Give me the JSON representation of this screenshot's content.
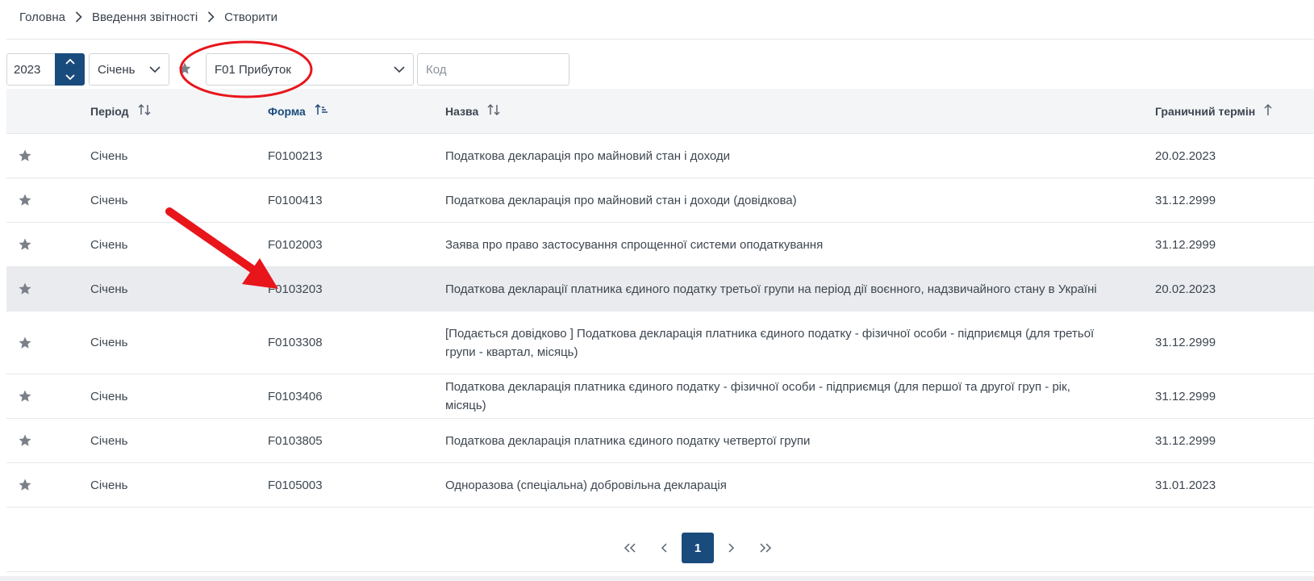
{
  "breadcrumb": [
    "Головна",
    "Введення звітності",
    "Створити"
  ],
  "filters": {
    "year": "2023",
    "month": "Січень",
    "form": "F01 Прибуток",
    "code_placeholder": "Код"
  },
  "table": {
    "columns": [
      "Період",
      "Форма",
      "Назва",
      "Граничний термін"
    ],
    "rows": [
      {
        "period": "Січень",
        "form": "F0100213",
        "name": "Податкова декларація про майновий стан і доходи",
        "deadline": "20.02.2023"
      },
      {
        "period": "Січень",
        "form": "F0100413",
        "name": "Податкова декларація про майновий стан і доходи (довідкова)",
        "deadline": "31.12.2999"
      },
      {
        "period": "Січень",
        "form": "F0102003",
        "name": "Заява про право застосування спрощенної системи оподаткування",
        "deadline": "31.12.2999"
      },
      {
        "period": "Січень",
        "form": "F0103203",
        "name": "Податкова декларації платника єдиного податку третьої групи на період дії воєнного, надзвичайного стану в Україні",
        "deadline": "20.02.2023"
      },
      {
        "period": "Січень",
        "form": "F0103308",
        "name": "[Подається довідково ] Податкова декларація платника єдиного податку - фізичної особи - підприємця (для третьої групи - квартал, місяць)",
        "deadline": "31.12.2999"
      },
      {
        "period": "Січень",
        "form": "F0103406",
        "name": "Податкова декларація платника єдиного податку - фізичної особи - підприємця (для першої та другої груп - рік, місяць)",
        "deadline": "31.12.2999"
      },
      {
        "period": "Січень",
        "form": "F0103805",
        "name": "Податкова декларація платника єдиного податку четвертої групи",
        "deadline": "31.12.2999"
      },
      {
        "period": "Січень",
        "form": "F0105003",
        "name": "Одноразова (спеціальна) добровільна декларація",
        "deadline": "31.01.2023"
      }
    ]
  },
  "pagination": {
    "current": "1"
  },
  "colors": {
    "primary": "#1a4b7d",
    "annotation": "#e8151b",
    "highlight_row": "#e9ebee"
  },
  "icons": [
    "chevron-right-icon",
    "chevron-up-icon",
    "chevron-down-icon",
    "star-icon",
    "sort-icon",
    "sort-asc-icon",
    "double-chevron-left-icon",
    "chevron-left-icon",
    "double-chevron-right-icon",
    "arrow-up-icon"
  ]
}
